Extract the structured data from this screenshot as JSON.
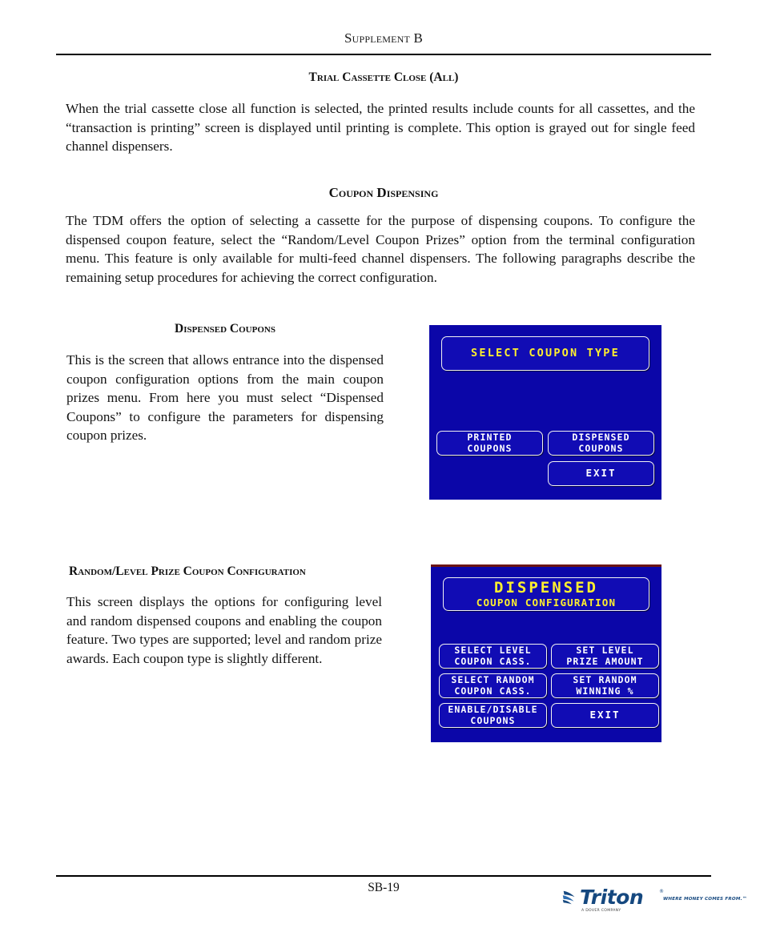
{
  "header": {
    "running_head": "Supplement B"
  },
  "sections": {
    "trial_cassette": {
      "heading": "Trial Cassette Close (All)",
      "paragraph": "When the trial cassette close all function is selected, the printed results include counts for all cassettes, and the “transaction is printing” screen is displayed until printing is complete.  This option is grayed out for single feed channel dispensers."
    },
    "coupon_dispensing": {
      "heading": "Coupon  Dispensing",
      "paragraph": "The TDM offers the option of selecting a cassette for the purpose of dispensing coupons.  To configure the dispensed coupon feature, select the “Random/Level Coupon Prizes” option from the terminal configuration menu. This feature is only available for multi-feed channel dispensers.  The following paragraphs describe the remaining setup procedures for achieving the correct configuration."
    },
    "dispensed_coupons": {
      "heading": "Dispensed Coupons",
      "paragraph": "This is the screen that allows entrance into the dispensed coupon configuration options from the main coupon prizes menu.  From here you must select “Dispensed Coupons” to configure the parameters for dispensing coupon prizes."
    },
    "random_level": {
      "heading": "Random/Level Prize Coupon Configuration",
      "paragraph": "This screen displays the options for configuring level and random dispensed coupons and enabling the coupon feature.  Two types are supported; level and random prize awards.  Each coupon type is slightly different."
    }
  },
  "screen_one": {
    "title": "SELECT COUPON TYPE",
    "buttons": [
      {
        "line1": "PRINTED",
        "line2": "COUPONS"
      },
      {
        "line1": "DISPENSED",
        "line2": "COUPONS"
      },
      {
        "line1": "EXIT",
        "line2": ""
      }
    ],
    "colors": {
      "background": "#0B06A8",
      "box_fill": "#110CB4",
      "border": "#F2F2F2",
      "title_text": "#FFF02E",
      "button_text": "#FFFFFF"
    }
  },
  "screen_two": {
    "title_line1": "DISPENSED",
    "title_line2": "COUPON CONFIGURATION",
    "buttons": [
      {
        "line1": "SELECT LEVEL",
        "line2": "COUPON CASS."
      },
      {
        "line1": "SET LEVEL",
        "line2": "PRIZE AMOUNT"
      },
      {
        "line1": "SELECT RANDOM",
        "line2": "COUPON CASS."
      },
      {
        "line1": "SET RANDOM",
        "line2": "WINNING %"
      },
      {
        "line1": "ENABLE/DISABLE",
        "line2": "COUPONS"
      },
      {
        "line1": "EXIT",
        "line2": ""
      }
    ],
    "colors": {
      "background": "#0B06A8",
      "top_edge": "#6B1414",
      "box_fill": "#110CB4",
      "border": "#F2F2F2",
      "title_text": "#FFF02E",
      "button_text": "#FFFFFF"
    }
  },
  "footer": {
    "page_number": "SB-19",
    "logo_word": "Triton",
    "logo_tm": "®",
    "logo_tagline": "WHERE MONEY COMES FROM.™",
    "logo_subtext": "A DOVER COMPANY"
  }
}
